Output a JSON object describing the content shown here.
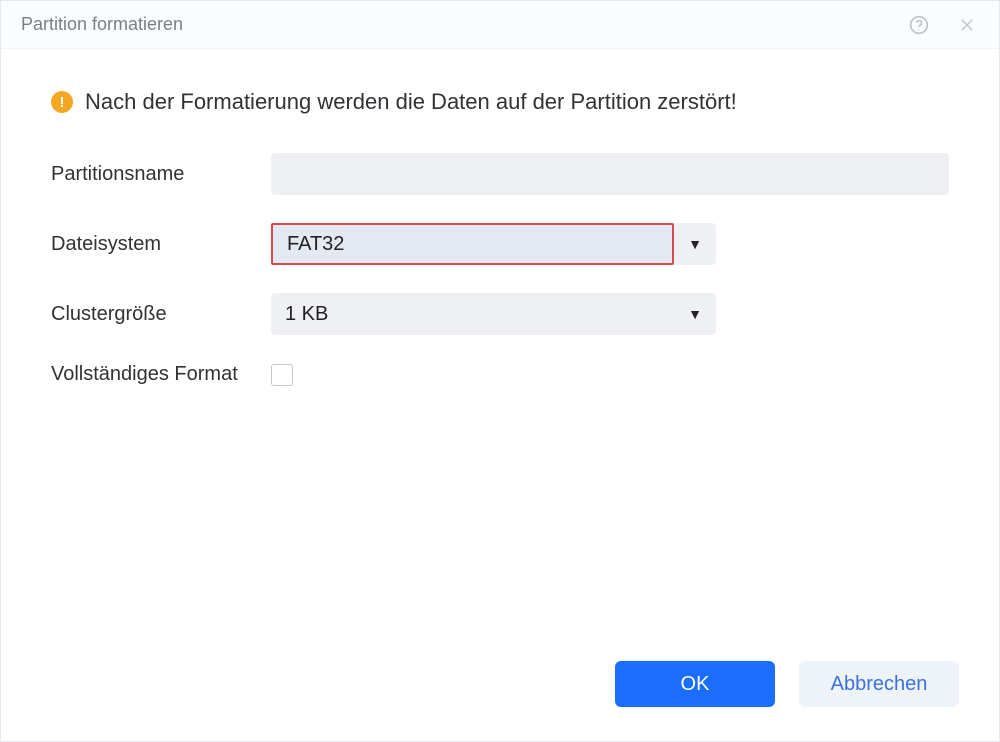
{
  "titlebar": {
    "title": "Partition formatieren"
  },
  "warning": {
    "text": "Nach der Formatierung werden die Daten auf der Partition zerstört!"
  },
  "form": {
    "partition_name": {
      "label": "Partitionsname",
      "value": ""
    },
    "filesystem": {
      "label": "Dateisystem",
      "value": "FAT32"
    },
    "cluster_size": {
      "label": "Clustergröße",
      "value": "1 KB"
    },
    "full_format": {
      "label": "Vollständiges Format",
      "checked": false
    }
  },
  "buttons": {
    "ok": "OK",
    "cancel": "Abbrechen"
  }
}
